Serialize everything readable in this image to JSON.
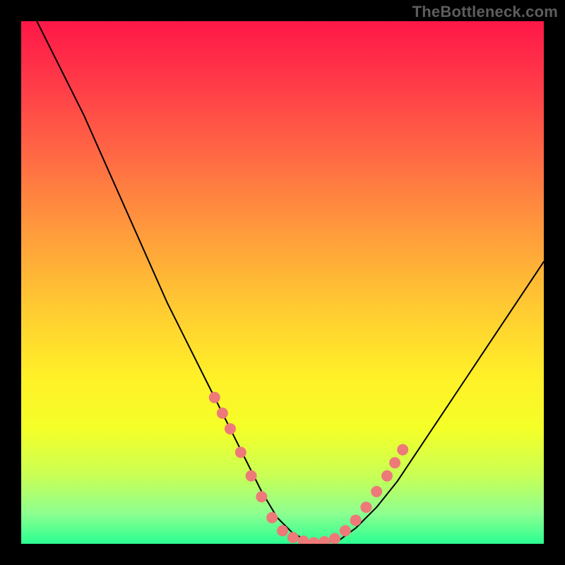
{
  "watermark": "TheBottleneck.com",
  "colors": {
    "gradient": [
      "#ff1748",
      "#ff3b48",
      "#ff6a44",
      "#ff9a3c",
      "#ffc832",
      "#fff028",
      "#f5ff28",
      "#c8ff55",
      "#8fff8f",
      "#2bff92"
    ],
    "curve": "#000000",
    "dot": "#ed7a78",
    "frame": "#000000"
  },
  "chart_data": {
    "type": "line",
    "title": "",
    "xlabel": "",
    "ylabel": "",
    "xlim": [
      0,
      100
    ],
    "ylim": [
      0,
      100
    ],
    "series": [
      {
        "name": "curve",
        "x": [
          3,
          8,
          12,
          16,
          20,
          24,
          28,
          32,
          36,
          40,
          43,
          46,
          49,
          52,
          55,
          58,
          61,
          64,
          68,
          72,
          76,
          80,
          84,
          88,
          92,
          96,
          100
        ],
        "y": [
          100,
          90,
          82,
          73,
          64,
          55,
          46,
          38,
          30,
          22,
          16,
          10,
          5,
          2,
          0.5,
          0.2,
          0.8,
          3,
          7,
          12,
          18,
          24,
          30,
          36,
          42,
          48,
          54
        ]
      }
    ],
    "annotations": {
      "dots_left_branch": [
        {
          "x": 37,
          "y": 28
        },
        {
          "x": 38.5,
          "y": 25
        },
        {
          "x": 40,
          "y": 22
        },
        {
          "x": 42,
          "y": 17.5
        },
        {
          "x": 44,
          "y": 13
        },
        {
          "x": 46,
          "y": 9
        },
        {
          "x": 48,
          "y": 5
        }
      ],
      "dots_valley": [
        {
          "x": 50,
          "y": 2.5
        },
        {
          "x": 52,
          "y": 1.2
        },
        {
          "x": 54,
          "y": 0.5
        },
        {
          "x": 56,
          "y": 0.2
        },
        {
          "x": 58,
          "y": 0.4
        },
        {
          "x": 60,
          "y": 1.0
        },
        {
          "x": 62,
          "y": 2.5
        },
        {
          "x": 64,
          "y": 4.5
        }
      ],
      "dots_right_branch": [
        {
          "x": 66,
          "y": 7
        },
        {
          "x": 68,
          "y": 10
        },
        {
          "x": 70,
          "y": 13
        },
        {
          "x": 71.5,
          "y": 15.5
        },
        {
          "x": 73,
          "y": 18
        }
      ]
    }
  }
}
